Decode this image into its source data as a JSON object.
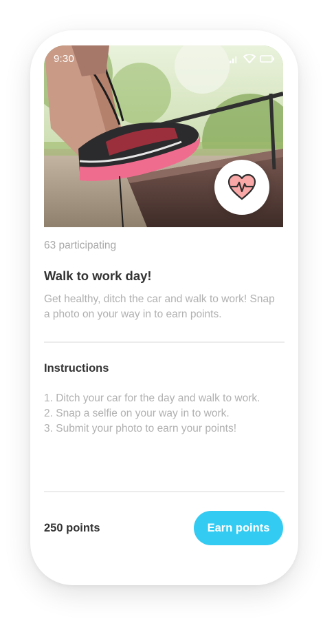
{
  "status_bar": {
    "time": "9:30",
    "icons": [
      "signal-icon",
      "wifi-icon",
      "battery-icon"
    ]
  },
  "hero": {
    "image": "photo-shoe-lacing",
    "badge_icon": "heartbeat-icon",
    "badge_color": "#f28a8a"
  },
  "challenge": {
    "participating": "63 participating",
    "title": "Walk to work day!",
    "description": "Get healthy, ditch the car and walk to work! Snap a photo on your way in to earn points."
  },
  "instructions": {
    "heading": "Instructions",
    "steps": [
      "1. Ditch your car for the day and walk to work.",
      "2. Snap a selfie on your way in to work.",
      "3. Submit your photo to earn your points!"
    ]
  },
  "footer": {
    "points": "250 points",
    "button_label": "Earn points"
  },
  "colors": {
    "accent": "#34cbf3",
    "text_dark": "#333333",
    "text_muted": "#b0b0b0"
  }
}
